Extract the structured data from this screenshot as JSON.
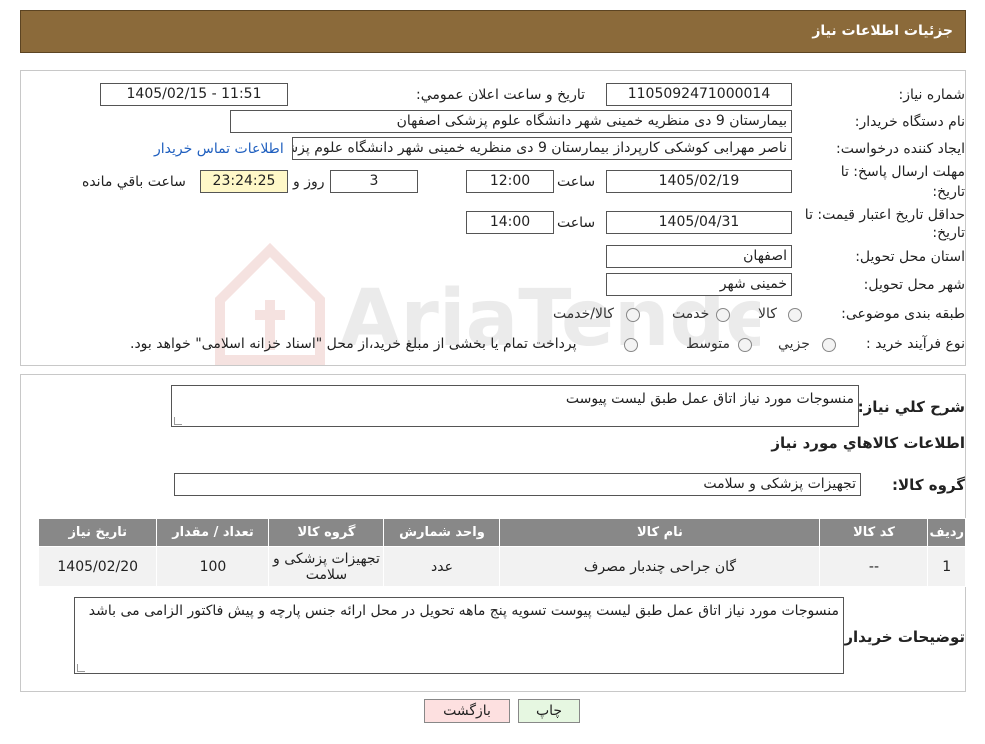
{
  "header": {
    "title": "جزئیات اطلاعات نیاز"
  },
  "details": {
    "need_number_label": "شماره نیاز:",
    "need_number": "1105092471000014",
    "announce_label": "تاریخ و ساعت اعلان عمومي:",
    "announce_value": "1405/02/15 - 11:51",
    "buyer_org_label": "نام دستگاه خریدار:",
    "buyer_org": "بیمارستان 9 دی منظریه خمینی شهر دانشگاه علوم پزشکی اصفهان",
    "creator_label": "ایجاد کننده درخواست:",
    "creator": "ناصر مهرابی کوشکی کارپرداز بیمارستان 9 دی منظریه خمینی شهر دانشگاه علوم پزشکی اصفهان",
    "contact_link": "اطلاعات تماس خریدار",
    "deadline_label_1": "مهلت ارسال پاسخ: تا",
    "deadline_label_2": "تاریخ:",
    "deadline_date": "1405/02/19",
    "time_label": "ساعت",
    "deadline_time": "12:00",
    "days_value": "3",
    "days_label": "روز و",
    "remaining_value": "23:24:25",
    "remaining_label": "ساعت باقي مانده",
    "price_valid_label_1": "حداقل تاریخ اعتبار قیمت: تا",
    "price_valid_label_2": "تاریخ:",
    "price_valid_date": "1405/04/31",
    "price_valid_time": "14:00",
    "province_label": "استان محل تحویل:",
    "province": "اصفهان",
    "city_label": "شهر محل تحویل:",
    "city": "خمینی شهر",
    "category_label": "طبقه بندی موضوعی:",
    "category_options": [
      "کالا",
      "خدمت",
      "کالا/خدمت"
    ],
    "process_label": "نوع فرآیند خرید :",
    "process_options": [
      "جزيي",
      "متوسط"
    ],
    "process_note": "پرداخت تمام یا بخشی از مبلغ خرید،از محل \"اسناد خزانه اسلامی\" خواهد بود."
  },
  "summary": {
    "desc_label": "شرح كلي نياز:",
    "desc_value": "منسوجات مورد نیاز اتاق عمل طبق لیست پیوست",
    "goods_title": "اطلاعات کالاهاي مورد نياز",
    "group_label": "گروه کالا:",
    "group_value": "تجهیزات پزشکی و سلامت"
  },
  "table": {
    "headers": [
      "رديف",
      "کد کالا",
      "نام کالا",
      "واحد شمارش",
      "گروه کالا",
      "تعداد / مقدار",
      "تاریخ نیاز"
    ],
    "rows": [
      [
        "1",
        "--",
        "گان جراحی چندبار مصرف",
        "عدد",
        "تجهیزات پزشکی و سلامت",
        "100",
        "1405/02/20"
      ]
    ]
  },
  "buyer_notes": {
    "label": "توضیحات خریدار:",
    "value": "منسوجات مورد نیاز اتاق عمل طبق لیست پیوست تسویه پنج ماهه تحویل در محل ارائه جنس پارچه و پیش فاکتور  الزامی می باشد"
  },
  "buttons": {
    "print": "چاپ",
    "back": "بازگشت"
  },
  "watermark": {
    "text": "AriaTender.net"
  },
  "colors": {
    "header": "#8b6a3a",
    "table_header": "#888888",
    "link": "#1f5fbf",
    "back_button": "#fde0e0",
    "print_button": "#e6f7e1"
  }
}
